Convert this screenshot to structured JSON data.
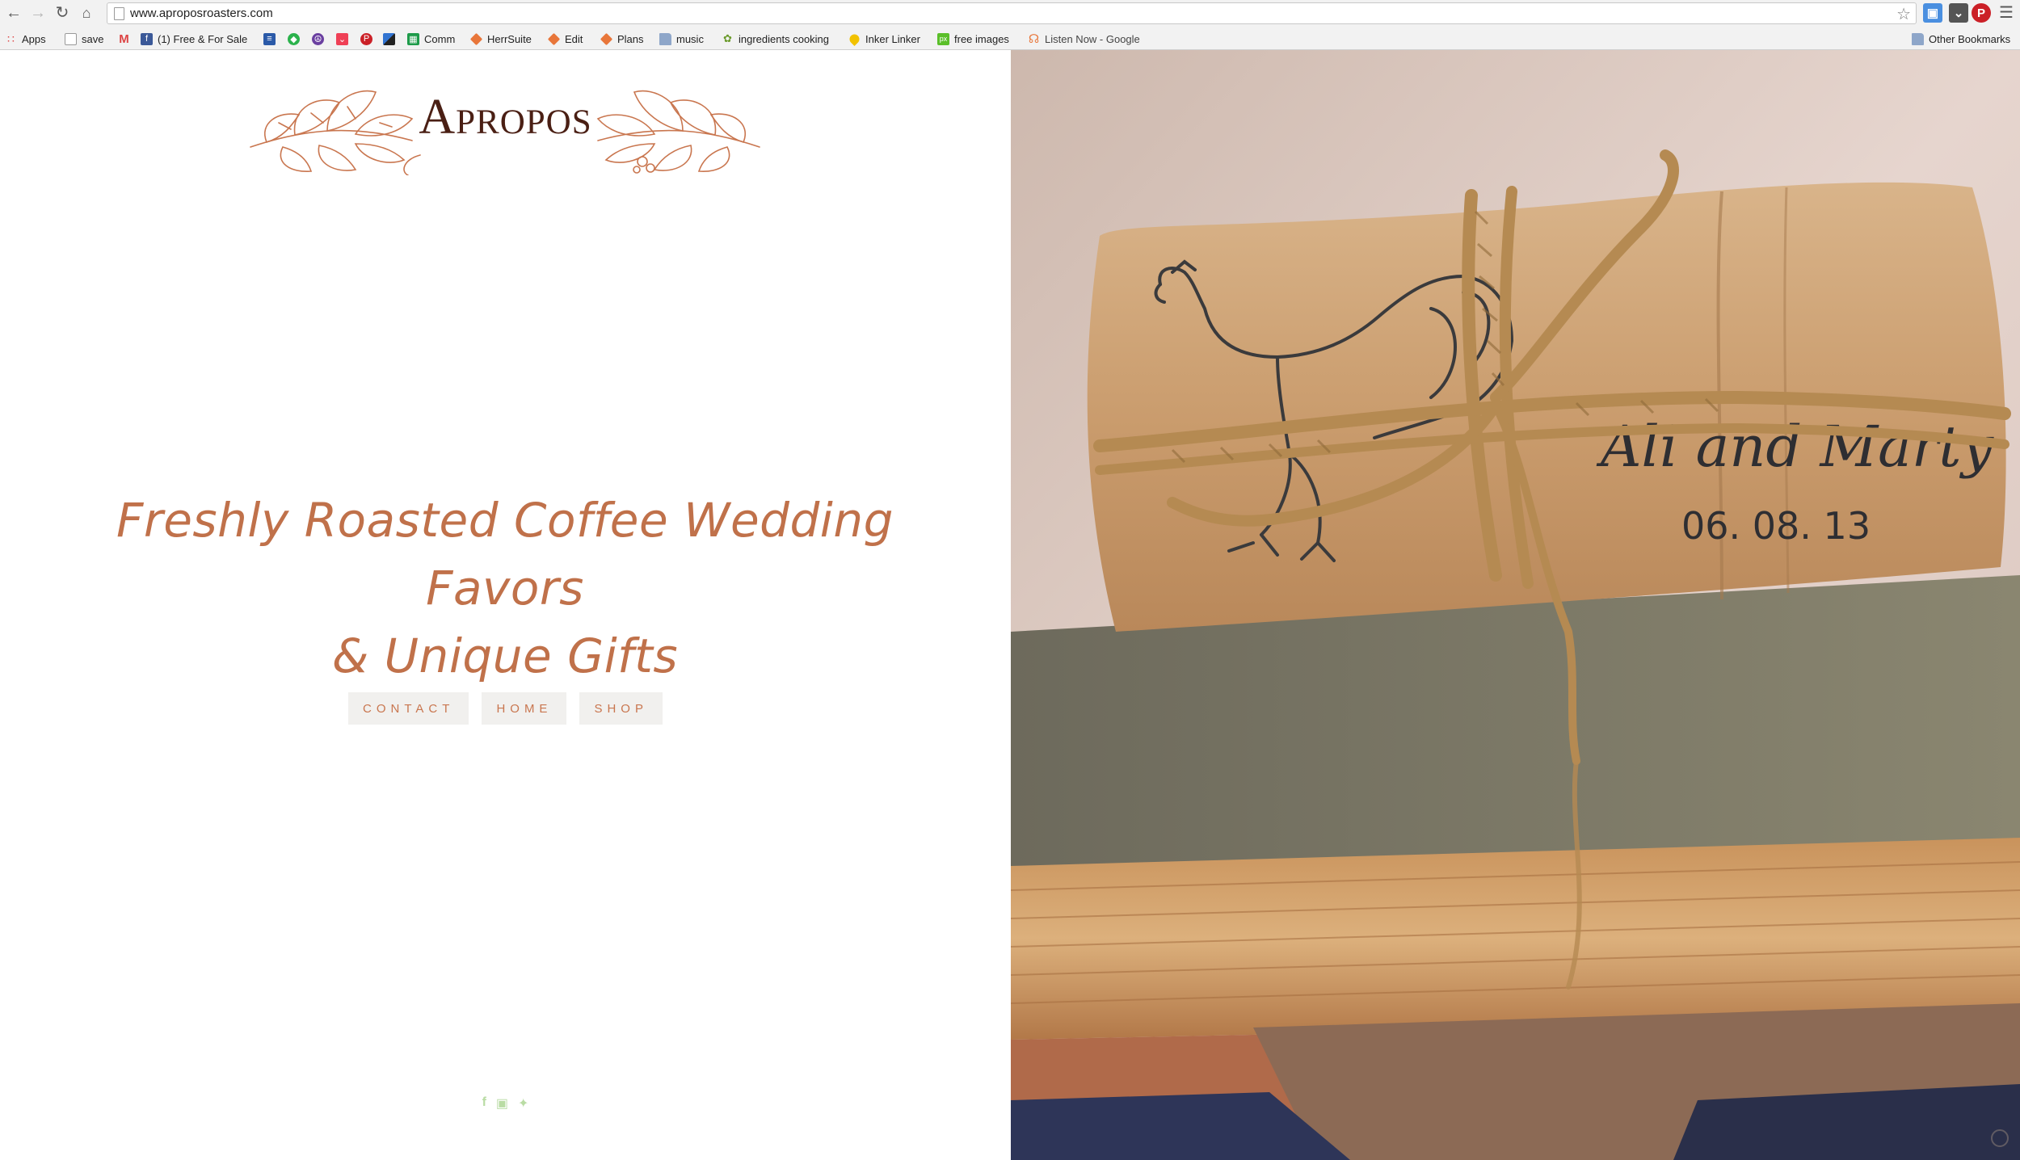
{
  "browser": {
    "url": "www.aproposroasters.com",
    "bookmarks": [
      {
        "label": "Apps",
        "icon": "apps-grid-icon"
      },
      {
        "label": "save",
        "icon": "page-icon"
      },
      {
        "label": "",
        "icon": "gmail-icon"
      },
      {
        "label": "(1) Free & For Sale",
        "icon": "facebook-icon"
      },
      {
        "label": "",
        "icon": "news-icon"
      },
      {
        "label": "",
        "icon": "feedly-icon"
      },
      {
        "label": "",
        "icon": "peace-icon"
      },
      {
        "label": "",
        "icon": "pocket-icon"
      },
      {
        "label": "",
        "icon": "pinterest-icon"
      },
      {
        "label": "",
        "icon": "delicious-icon"
      },
      {
        "label": "Comm",
        "icon": "sheets-icon"
      },
      {
        "label": "HerrSuite",
        "icon": "diamond-icon"
      },
      {
        "label": "Edit",
        "icon": "diamond-icon"
      },
      {
        "label": "Plans",
        "icon": "diamond-icon"
      },
      {
        "label": "music",
        "icon": "folder-icon"
      },
      {
        "label": "ingredients cooking",
        "icon": "leaf-icon"
      },
      {
        "label": "Inker Linker",
        "icon": "drop-icon"
      },
      {
        "label": "free images",
        "icon": "px-icon"
      },
      {
        "label": "Listen Now - Google",
        "icon": "headphones-icon"
      }
    ],
    "other_bookmarks": "Other Bookmarks"
  },
  "site": {
    "brand": "Apropos",
    "tagline_line1": "Freshly Roasted Coffee Wedding Favors",
    "tagline_line2": "& Unique Gifts",
    "nav": [
      "CONTACT",
      "HOME",
      "SHOP"
    ],
    "social": [
      "facebook-icon",
      "instagram-icon",
      "twitter-icon"
    ]
  },
  "photo": {
    "names": "Ali and Marty",
    "date": "06. 08. 13"
  },
  "colors": {
    "accent": "#c9764f",
    "logo": "#4a1f14",
    "social": "#b9dca4"
  }
}
